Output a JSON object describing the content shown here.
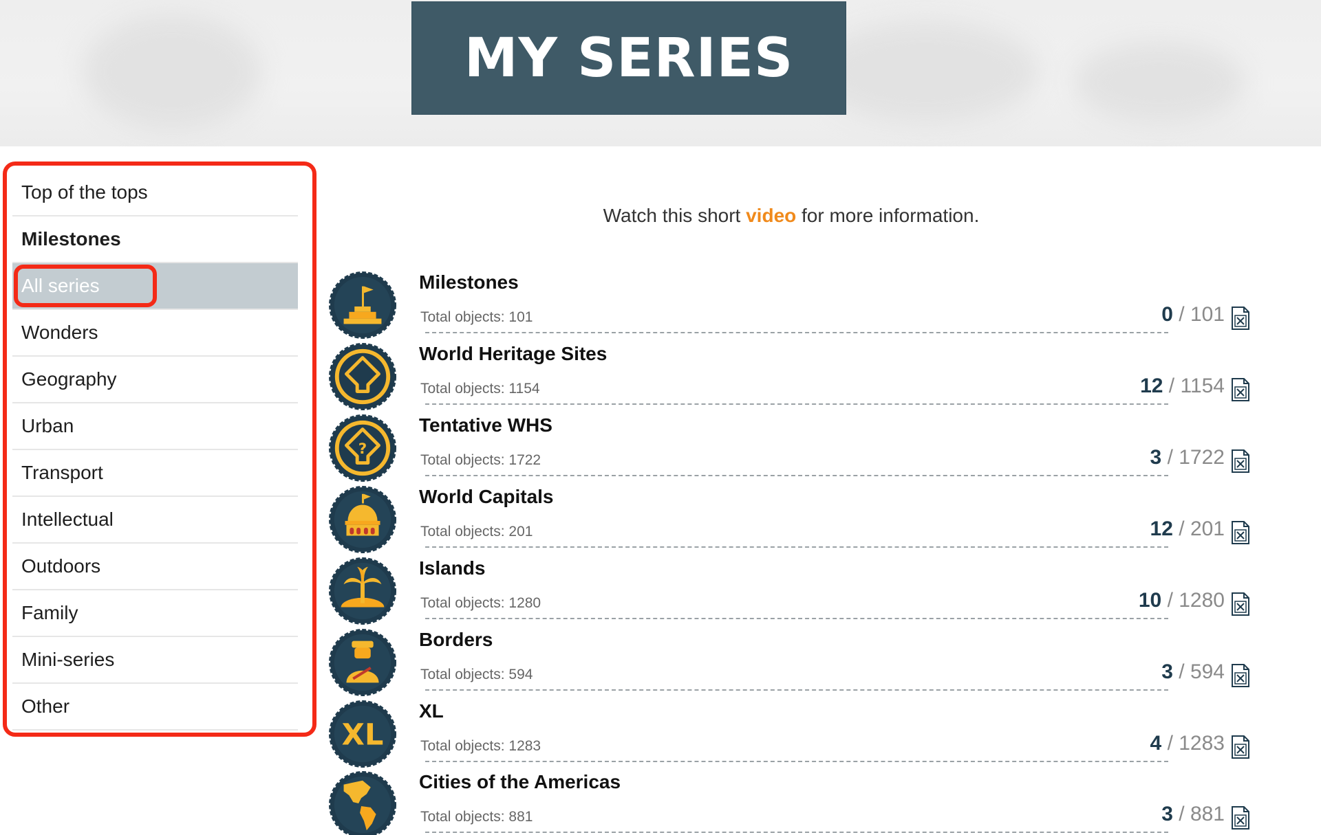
{
  "header": {
    "title": "MY SERIES"
  },
  "sidebar": {
    "items": [
      {
        "label": "Top of the tops",
        "bold": false,
        "active": false
      },
      {
        "label": "Milestones",
        "bold": true,
        "active": false
      },
      {
        "label": "All series",
        "bold": false,
        "active": true
      },
      {
        "label": "Wonders",
        "bold": false,
        "active": false
      },
      {
        "label": "Geography",
        "bold": false,
        "active": false
      },
      {
        "label": "Urban",
        "bold": false,
        "active": false
      },
      {
        "label": "Transport",
        "bold": false,
        "active": false
      },
      {
        "label": "Intellectual",
        "bold": false,
        "active": false
      },
      {
        "label": "Outdoors",
        "bold": false,
        "active": false
      },
      {
        "label": "Family",
        "bold": false,
        "active": false
      },
      {
        "label": "Mini-series",
        "bold": false,
        "active": false
      },
      {
        "label": "Other",
        "bold": false,
        "active": false
      }
    ]
  },
  "intro": {
    "before": "Watch this short ",
    "link": "video",
    "after": " for more information."
  },
  "series": [
    {
      "name": "Milestones",
      "total_label": "Total objects: 101",
      "have": "0",
      "total": "101",
      "icon": "milestone-flag-icon"
    },
    {
      "name": "World Heritage Sites",
      "total_label": "Total objects: 1154",
      "have": "12",
      "total": "1154",
      "icon": "world-heritage-icon"
    },
    {
      "name": "Tentative WHS",
      "total_label": "Total objects: 1722",
      "have": "3",
      "total": "1722",
      "icon": "tentative-whs-icon"
    },
    {
      "name": "World Capitals",
      "total_label": "Total objects: 201",
      "have": "12",
      "total": "201",
      "icon": "capitol-dome-icon"
    },
    {
      "name": "Islands",
      "total_label": "Total objects: 1280",
      "have": "10",
      "total": "1280",
      "icon": "palm-island-icon"
    },
    {
      "name": "Borders",
      "total_label": "Total objects: 594",
      "have": "3",
      "total": "594",
      "icon": "border-guard-icon"
    },
    {
      "name": "XL",
      "total_label": "Total objects: 1283",
      "have": "4",
      "total": "1283",
      "icon": "xl-icon"
    },
    {
      "name": "Cities of the Americas",
      "total_label": "Total objects: 881",
      "have": "3",
      "total": "881",
      "icon": "americas-map-icon"
    }
  ],
  "colors": {
    "title_bg": "#3f5a67",
    "highlight_red": "#f42a17",
    "link_orange": "#f08a1c",
    "badge_dark": "#1f3b4d",
    "badge_gold": "#f5b82e",
    "active_bg": "#c3ccd1"
  }
}
